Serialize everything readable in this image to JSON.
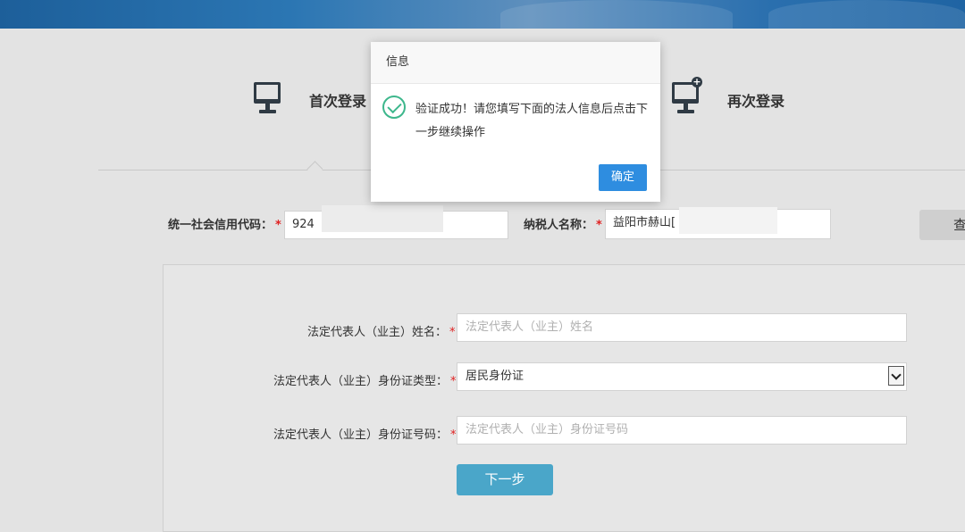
{
  "tabs": {
    "first_login": "首次登录",
    "again_login": "再次登录"
  },
  "credit_code": {
    "label": "统一社会信用代码：",
    "required": "*",
    "value": "924"
  },
  "taxpayer_name": {
    "label": "纳税人名称：",
    "required": "*",
    "value": "益阳市赫山[",
    "query_button": "查"
  },
  "form": {
    "legal_name_label": "法定代表人（业主）姓名：",
    "legal_name_placeholder": "法定代表人（业主）姓名",
    "id_type_label": "法定代表人（业主）身份证类型：",
    "id_type_value": "居民身份证",
    "id_number_label": "法定代表人（业主）身份证号码：",
    "id_number_placeholder": "法定代表人（业主）身份证号码",
    "required": "*",
    "next_button": "下一步"
  },
  "dialog": {
    "title": "信息",
    "message": "验证成功！请您填写下面的法人信息后点击下一步继续操作",
    "ok_button": "确定",
    "icon": "check-circle-icon"
  },
  "colors": {
    "banner": "#2b76b3",
    "ok_button": "#2e8de0",
    "next_button": "#4aa6c9",
    "check": "#3db78c",
    "required": "#e02020"
  }
}
